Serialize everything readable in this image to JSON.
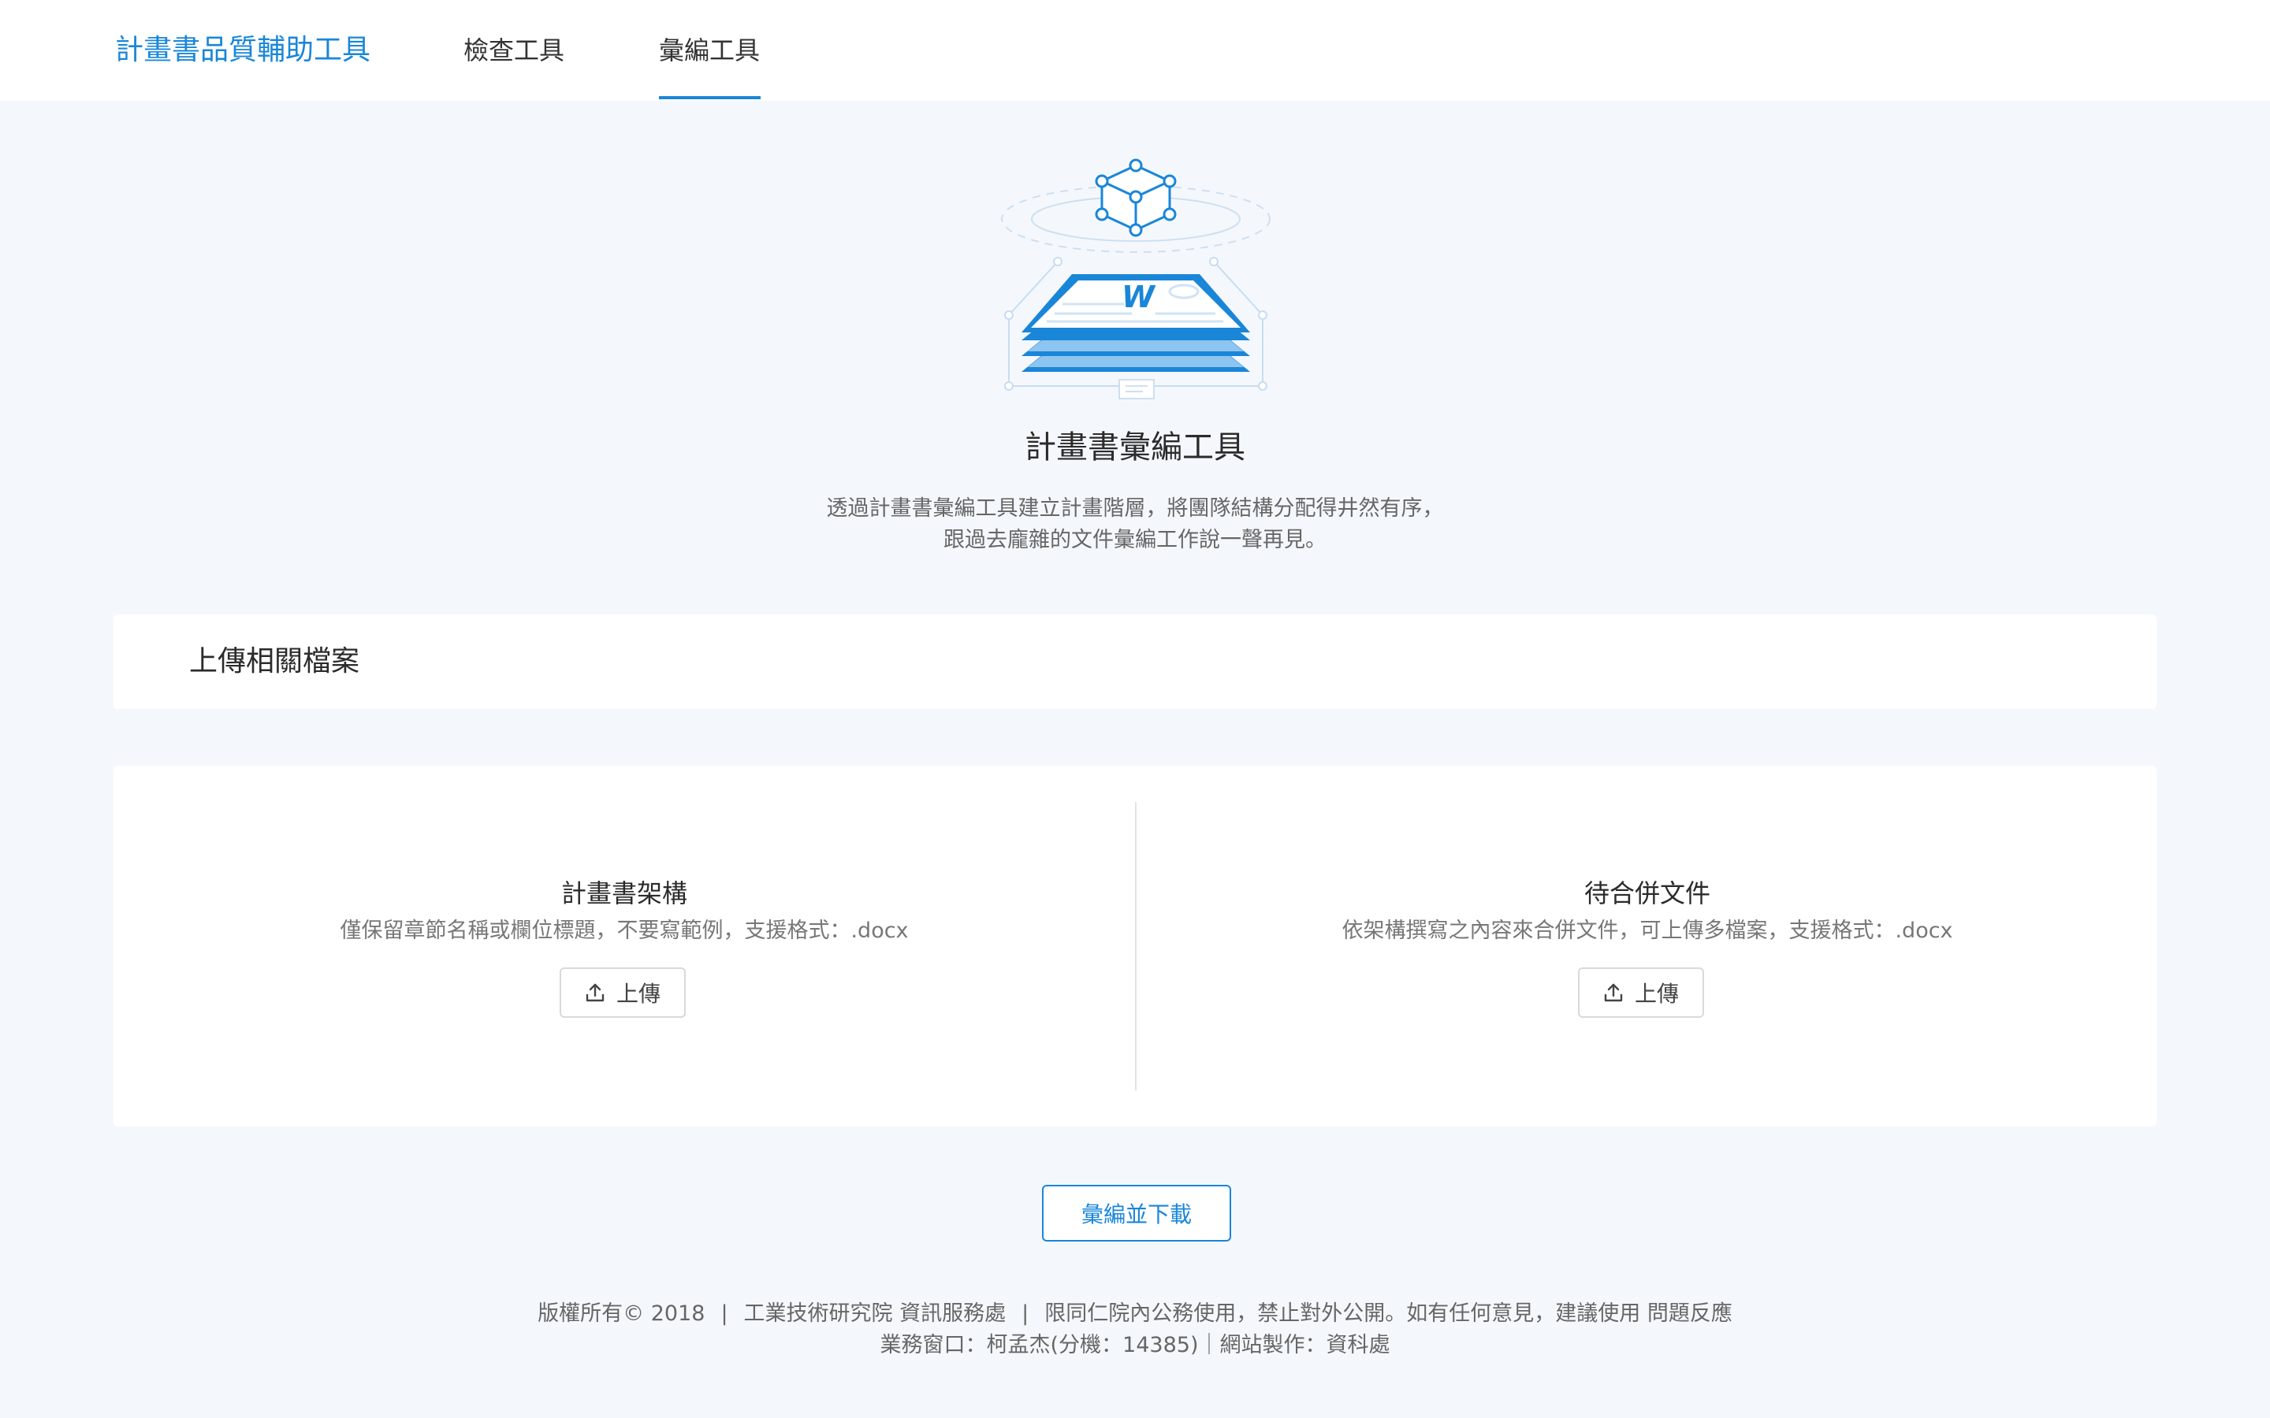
{
  "header": {
    "brand": "計畫書品質輔助工具",
    "tabs": [
      {
        "label": "檢查工具"
      },
      {
        "label": "彙編工具"
      }
    ],
    "active_tab": "彙編工具"
  },
  "hero": {
    "title": "計畫書彙編工具",
    "desc_line1": "透過計畫書彙編工具建立計畫階層，將團隊結構分配得井然有序，",
    "desc_line2": "跟過去龐雜的文件彙編工作說一聲再見。"
  },
  "upload_section": {
    "title": "上傳相關檔案"
  },
  "columns": {
    "left": {
      "title": "計畫書架構",
      "desc": "僅保留章節名稱或欄位標題，不要寫範例，支援格式：.docx",
      "button": "上傳"
    },
    "right": {
      "title": "待合併文件",
      "desc": "依架構撰寫之內容來合併文件，可上傳多檔案，支援格式：.docx",
      "button": "上傳"
    }
  },
  "merge_button": "彙編並下載",
  "footer": {
    "copyright": "版權所有© 2018",
    "sep": "|",
    "org": "工業技術研究院 資訊服務處",
    "notice": "限同仁院內公務使用，禁止對外公開。如有任何意見，建議使用",
    "feedback_link": "問題反應",
    "contact": "業務窗口：柯孟杰(分機：14385)｜網站製作：資科處"
  },
  "colors": {
    "accent": "#1a86d8",
    "background": "#f4f8fd"
  }
}
